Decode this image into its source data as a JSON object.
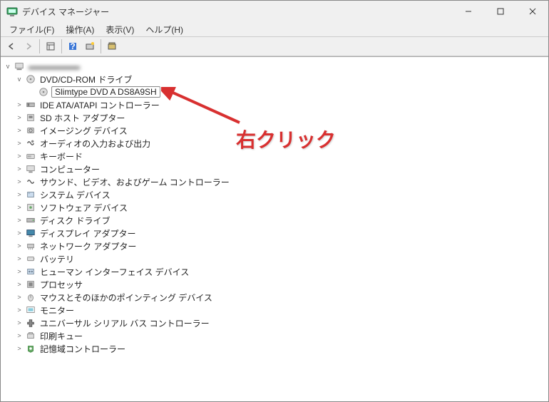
{
  "window": {
    "title": "デバイス マネージャー"
  },
  "menu": {
    "file": "ファイル(F)",
    "action": "操作(A)",
    "view": "表示(V)",
    "help": "ヘルプ(H)"
  },
  "tree": {
    "root": "",
    "dvd_category": "DVD/CD-ROM ドライブ",
    "dvd_device": "Slimtype DVD A  DS8A9SH",
    "items": [
      "IDE ATA/ATAPI コントローラー",
      "SD ホスト アダプター",
      "イメージング デバイス",
      "オーディオの入力および出力",
      "キーボード",
      "コンピューター",
      "サウンド、ビデオ、およびゲーム コントローラー",
      "システム デバイス",
      "ソフトウェア デバイス",
      "ディスク ドライブ",
      "ディスプレイ アダプター",
      "ネットワーク アダプター",
      "バッテリ",
      "ヒューマン インターフェイス デバイス",
      "プロセッサ",
      "マウスとそのほかのポインティング デバイス",
      "モニター",
      "ユニバーサル シリアル バス コントローラー",
      "印刷キュー",
      "記憶域コントローラー"
    ]
  },
  "annotation": {
    "text": "右クリック"
  }
}
